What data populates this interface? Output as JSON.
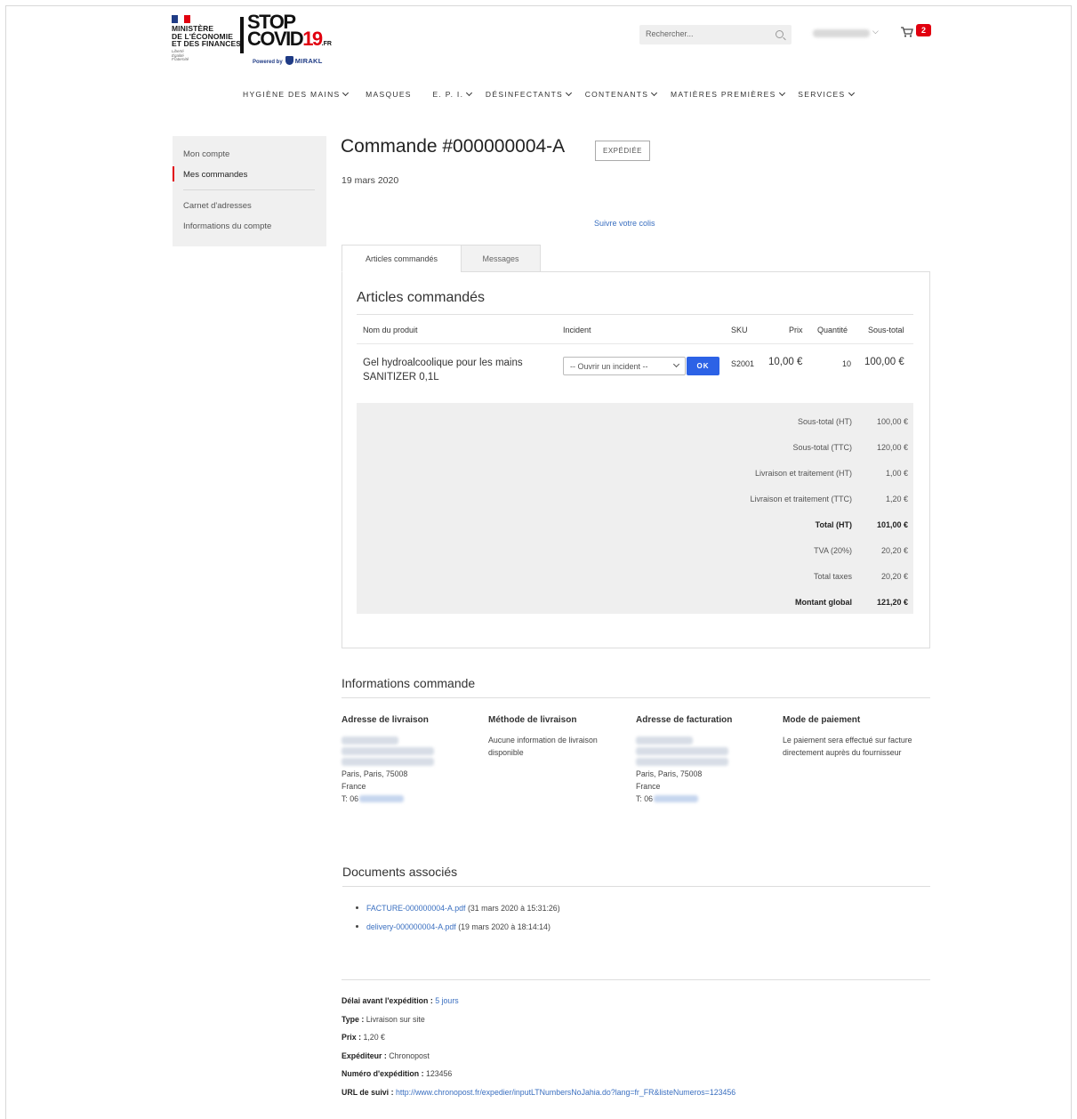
{
  "header": {
    "ministry_lines": [
      "MINISTÈRE",
      "DE L'ÉCONOMIE",
      "ET DES FINANCES"
    ],
    "ministry_motto": [
      "Liberté",
      "Égalité",
      "Fraternité"
    ],
    "logo_top": "STOP",
    "logo_covid": "COVID",
    "logo_19": "19",
    "logo_fr": ".FR",
    "powered_by": "Powered by",
    "mirakl": "MIRAKL",
    "search_placeholder": "Rechercher...",
    "cart_count": "2",
    "colors": {
      "brand_red": "#e1000f",
      "brand_blue": "#1f3b85",
      "link": "#3a6fc0",
      "button": "#2c62e6"
    }
  },
  "nav": {
    "items": [
      "HYGIÈNE DES MAINS",
      "MASQUES",
      "E. P. I.",
      "DÉSINFECTANTS",
      "CONTENANTS",
      "MATIÈRES PREMIÈRES",
      "SERVICES"
    ]
  },
  "sidebar": {
    "items": [
      {
        "label": "Mon compte"
      },
      {
        "label": "Mes commandes"
      },
      {
        "label": "Carnet d'adresses"
      },
      {
        "label": "Informations du compte"
      }
    ]
  },
  "order": {
    "title": "Commande #000000004-A",
    "status": "EXPÉDIÉE",
    "date": "19 mars 2020",
    "track_link": "Suivre votre colis",
    "tabs": [
      "Articles commandés",
      "Messages"
    ]
  },
  "articles": {
    "title": "Articles commandés",
    "headers": [
      "Nom du produit",
      "Incident",
      "SKU",
      "Prix",
      "Quantité",
      "Sous-total"
    ],
    "row": {
      "name": "Gel hydroalcoolique pour les mains SANITIZER 0,1L",
      "incident_select": "-- Ouvrir un incident --",
      "ok_button": "OK",
      "sku": "S2001",
      "price": "10,00 €",
      "qty": "10",
      "subtotal": "100,00 €"
    },
    "totals": [
      {
        "label": "Sous-total (HT)",
        "value": "100,00 €"
      },
      {
        "label": "Sous-total (TTC)",
        "value": "120,00 €"
      },
      {
        "label": "Livraison et traitement (HT)",
        "value": "1,00 €"
      },
      {
        "label": "Livraison et traitement (TTC)",
        "value": "1,20 €"
      },
      {
        "label": "Total (HT)",
        "value": "101,00 €"
      },
      {
        "label": "TVA (20%)",
        "value": "20,20 €"
      },
      {
        "label": "Total taxes",
        "value": "20,20 €"
      },
      {
        "label": "Montant global",
        "value": "121,20 €"
      }
    ]
  },
  "info": {
    "title": "Informations commande",
    "delivery_address": {
      "heading": "Adresse de livraison",
      "city": "Paris, Paris, 75008",
      "country": "France",
      "tel_prefix": "T: 06"
    },
    "delivery_method": {
      "heading": "Méthode de livraison",
      "text": "Aucune information de livraison disponible"
    },
    "billing_address": {
      "heading": "Adresse de facturation",
      "city": "Paris, Paris, 75008",
      "country": "France",
      "tel_prefix": "T: 06"
    },
    "payment": {
      "heading": "Mode de paiement",
      "text": "Le paiement sera effectué sur facture directement auprès du fournisseur"
    }
  },
  "documents": {
    "title": "Documents associés",
    "items": [
      {
        "name": "FACTURE-000000004-A.pdf",
        "date": "(31 mars 2020 à 15:31:26)"
      },
      {
        "name": "delivery-000000004-A.pdf",
        "date": "(19 mars 2020 à 18:14:14)"
      }
    ]
  },
  "shipping": {
    "delay_label": "Délai avant l'expédition :",
    "delay_value": "5 jours",
    "type_label": "Type :",
    "type_value": "Livraison sur site",
    "price_label": "Prix :",
    "price_value": "1,20 €",
    "carrier_label": "Expéditeur :",
    "carrier_value": "Chronopost",
    "number_label": "Numéro d'expédition :",
    "number_value": "123456",
    "url_label": "URL de suivi :",
    "url_value": "http://www.chronopost.fr/expedier/inputLTNumbersNoJahia.do?lang=fr_FR&listeNumeros=123456"
  }
}
